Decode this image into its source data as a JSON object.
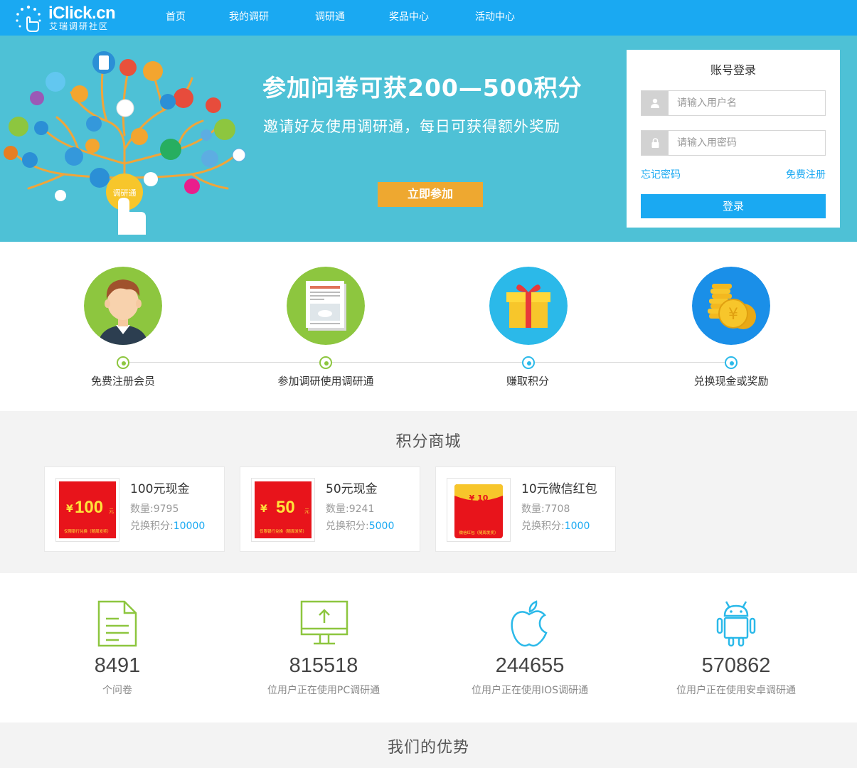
{
  "nav": {
    "logo_text": "iClick.cn",
    "logo_sub": "艾瑞调研社区",
    "items": [
      "首页",
      "我的调研",
      "调研通",
      "奖品中心",
      "活动中心"
    ]
  },
  "banner": {
    "headline": "参加问卷可获200—500积分",
    "subline": "邀请好友使用调研通，每日可获得额外奖励",
    "join_button": "立即参加",
    "tree_button_label": "调研通"
  },
  "login": {
    "title": "账号登录",
    "username_placeholder": "请输入用户名",
    "password_placeholder": "请输入用密码",
    "forgot": "忘记密码",
    "register": "免费注册",
    "submit": "登录"
  },
  "steps": [
    {
      "label": "免费注册会员",
      "dot": "green"
    },
    {
      "label": "参加调研使用调研通",
      "dot": "green"
    },
    {
      "label": "赚取积分",
      "dot": "blue"
    },
    {
      "label": "兑换现金或奖励",
      "dot": "blue"
    }
  ],
  "mall": {
    "title": "积分商城",
    "items": [
      {
        "name": "100元现金",
        "qty_label": "数量:",
        "qty": "9795",
        "pts_label": "兑换积分:",
        "pts": "10000",
        "img_value": "100",
        "img_currency": "¥",
        "img_unit": "元",
        "img_caption": "仅限银行兑换（随周发奖）"
      },
      {
        "name": "50元现金",
        "qty_label": "数量:",
        "qty": "9241",
        "pts_label": "兑换积分:",
        "pts": "5000",
        "img_value": "50",
        "img_currency": "¥",
        "img_unit": "元",
        "img_caption": "仅限银行兑换（随周发奖）"
      },
      {
        "name": "10元微信红包",
        "qty_label": "数量:",
        "qty": "7708",
        "pts_label": "兑换积分:",
        "pts": "1000",
        "img_value": "¥ 10",
        "img_caption": "微信红包（随周发奖）"
      }
    ]
  },
  "stats": [
    {
      "value": "8491",
      "label": "个问卷",
      "icon": "document-icon"
    },
    {
      "value": "815518",
      "label": "位用户正在使用PC调研通",
      "icon": "monitor-upload-icon"
    },
    {
      "value": "244655",
      "label": "位用户正在使用IOS调研通",
      "icon": "apple-icon"
    },
    {
      "value": "570862",
      "label": "位用户正在使用安卓调研通",
      "icon": "android-icon"
    }
  ],
  "advantage": {
    "title": "我们的优势"
  },
  "colors": {
    "nav": "#1aa9f2",
    "banner": "#4ec1d6",
    "join_button": "#eea830",
    "green": "#8dc63f",
    "blue": "#2bb9e9",
    "link": "#1aa9f2"
  }
}
